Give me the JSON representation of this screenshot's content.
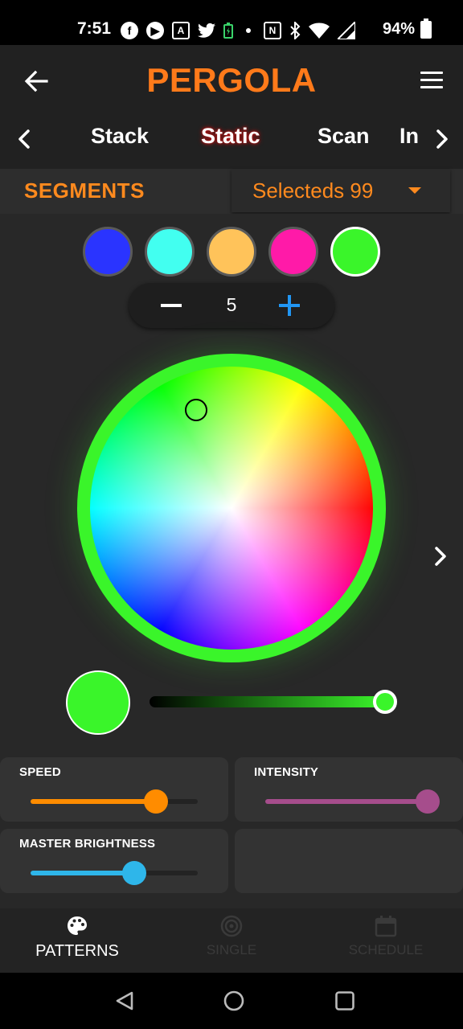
{
  "status_bar": {
    "time": "7:51",
    "icons": [
      "facebook-icon",
      "messenger-icon",
      "translate-icon",
      "twitter-icon",
      "battery-saver-icon",
      "dot-icon",
      "nfc-icon",
      "bluetooth-icon",
      "wifi-icon",
      "signal-icon"
    ],
    "battery_percent": "94%"
  },
  "app_bar": {
    "title": "PERGOLA",
    "title_color": "#ff7a1a"
  },
  "tabs": {
    "items": [
      "Stack",
      "Static",
      "Scan",
      "In"
    ],
    "active": "Static"
  },
  "segments": {
    "label": "SEGMENTS",
    "selected_text": "Selecteds 99",
    "accent_color": "#ff8a1e"
  },
  "swatches": [
    {
      "color": "#2a34ff",
      "selected": false
    },
    {
      "color": "#42fff0",
      "selected": false
    },
    {
      "color": "#ffc35a",
      "selected": false
    },
    {
      "color": "#ff1aa8",
      "selected": false
    },
    {
      "color": "#3af52a",
      "selected": true
    }
  ],
  "stepper": {
    "value": "5"
  },
  "color": {
    "current": "#3af52a",
    "brightness": 1.0
  },
  "sliders": {
    "speed": {
      "label": "SPEED",
      "value": 0.75,
      "color": "#ff8c00"
    },
    "intensity": {
      "label": "INTENSITY",
      "value": 0.97,
      "color": "#a64d8c"
    },
    "master_brightness": {
      "label": "MASTER BRIGHTNESS",
      "value": 0.62,
      "color": "#2eb6ea"
    }
  },
  "bottom_nav": {
    "items": [
      {
        "label": "PATTERNS",
        "icon": "palette-icon",
        "active": true
      },
      {
        "label": "SINGLE",
        "icon": "target-icon",
        "active": false
      },
      {
        "label": "SCHEDULE",
        "icon": "calendar-icon",
        "active": false
      }
    ]
  },
  "system_nav": {
    "icons": [
      "back-triangle-icon",
      "home-circle-icon",
      "recents-square-icon"
    ]
  }
}
